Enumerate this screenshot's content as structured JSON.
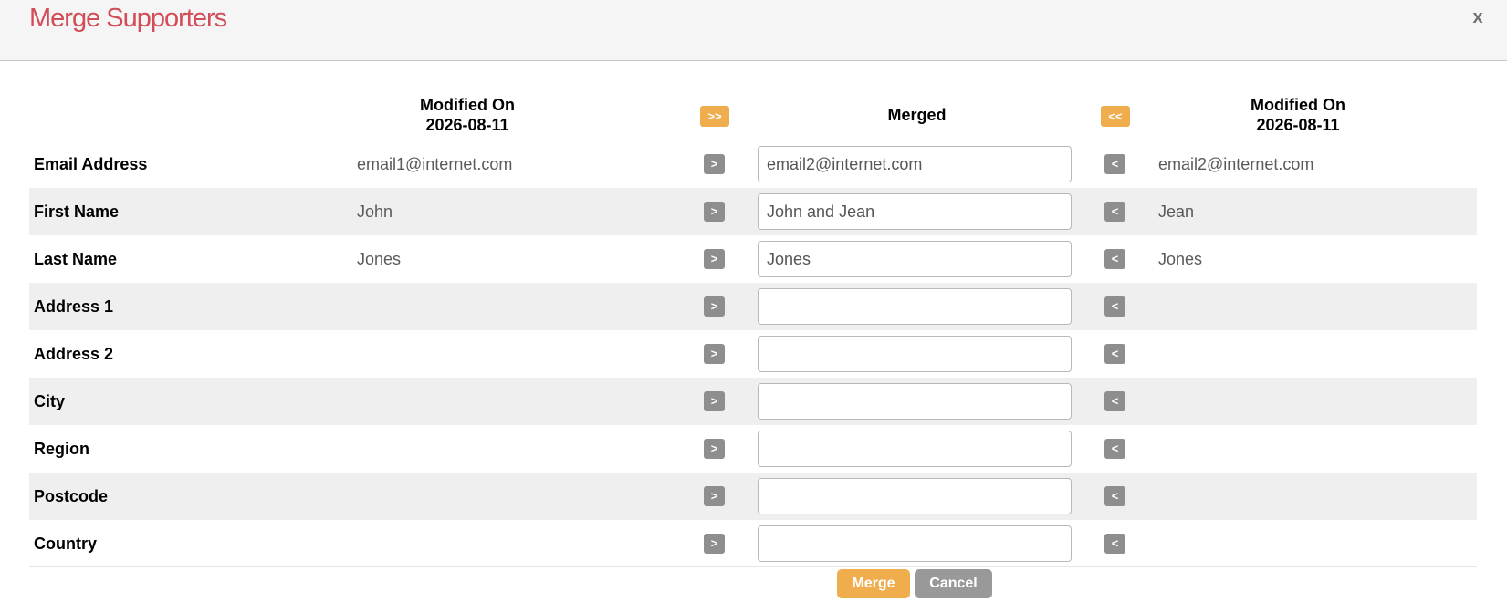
{
  "dialog": {
    "title": "Merge Supporters",
    "close_label": "x"
  },
  "columns": {
    "left": {
      "label": "Modified On",
      "date": "2026-08-11"
    },
    "merged": {
      "label": "Merged"
    },
    "right": {
      "label": "Modified On",
      "date": "2026-08-11"
    },
    "copy_all_right_label": ">>",
    "copy_all_left_label": "<<"
  },
  "copy_right_label": ">",
  "copy_left_label": "<",
  "rows": [
    {
      "label": "Email Address",
      "left": "email1@internet.com",
      "merged": "email2@internet.com",
      "right": "email2@internet.com"
    },
    {
      "label": "First Name",
      "left": "John",
      "merged": "John and Jean",
      "right": "Jean"
    },
    {
      "label": "Last Name",
      "left": "Jones",
      "merged": "Jones",
      "right": "Jones"
    },
    {
      "label": "Address 1",
      "left": "",
      "merged": "",
      "right": ""
    },
    {
      "label": "Address 2",
      "left": "",
      "merged": "",
      "right": ""
    },
    {
      "label": "City",
      "left": "",
      "merged": "",
      "right": ""
    },
    {
      "label": "Region",
      "left": "",
      "merged": "",
      "right": ""
    },
    {
      "label": "Postcode",
      "left": "",
      "merged": "",
      "right": ""
    },
    {
      "label": "Country",
      "left": "",
      "merged": "",
      "right": ""
    }
  ],
  "actions": {
    "merge_label": "Merge",
    "cancel_label": "Cancel"
  },
  "colors": {
    "title": "#d24d57",
    "accent": "#f0ad4e",
    "neutral_button": "#999999",
    "copy_button": "#8e8e8e"
  }
}
